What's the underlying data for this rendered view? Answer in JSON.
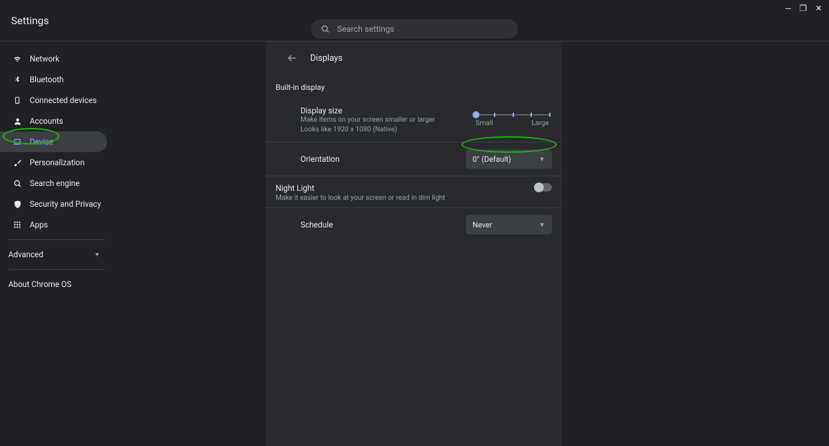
{
  "header": {
    "title": "Settings"
  },
  "search": {
    "placeholder": "Search settings"
  },
  "sidebar": {
    "items": [
      {
        "label": "Network"
      },
      {
        "label": "Bluetooth"
      },
      {
        "label": "Connected devices"
      },
      {
        "label": "Accounts"
      },
      {
        "label": "Device"
      },
      {
        "label": "Personalization"
      },
      {
        "label": "Search engine"
      },
      {
        "label": "Security and Privacy"
      },
      {
        "label": "Apps"
      }
    ],
    "advanced_label": "Advanced",
    "about_label": "About Chrome OS"
  },
  "main": {
    "page_title": "Displays",
    "builtin_title": "Built-in display",
    "display_size": {
      "label": "Display size",
      "sub1": "Make items on your screen smaller or larger",
      "sub2": "Looks like 1920 x 1080 (Native)",
      "min_label": "Small",
      "max_label": "Large"
    },
    "orientation": {
      "label": "Orientation",
      "value": "0° (Default)"
    },
    "night_light": {
      "title": "Night Light",
      "sub": "Make it easier to look at your screen or read in dim light"
    },
    "schedule": {
      "label": "Schedule",
      "value": "Never"
    }
  }
}
